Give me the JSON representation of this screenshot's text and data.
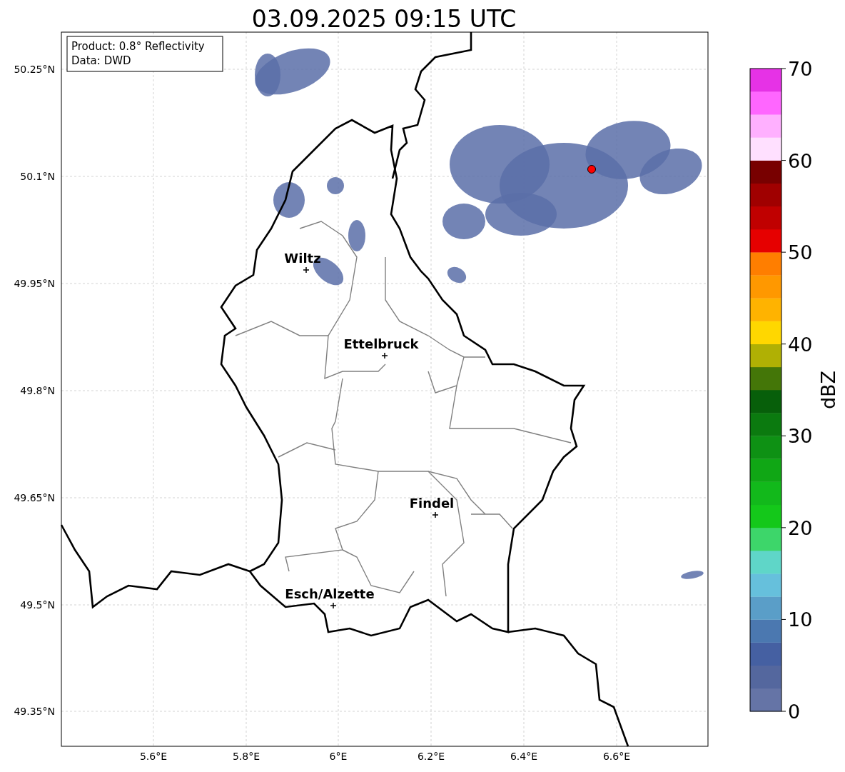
{
  "title": "03.09.2025 09:15 UTC",
  "info_box": [
    "Product: 0.8° Reflectivity",
    "Data: DWD"
  ],
  "lat_labels": [
    "50.25°N",
    "50.1°N",
    "49.95°N",
    "49.8°N",
    "49.65°N",
    "49.5°N",
    "49.35°N"
  ],
  "lon_labels": [
    "5.6°E",
    "5.8°E",
    "6°E",
    "6.2°E",
    "6.4°E",
    "6.6°E"
  ],
  "cities": [
    {
      "name": "Wiltz"
    },
    {
      "name": "Ettelbruck"
    },
    {
      "name": "Findel"
    },
    {
      "name": "Esch/Alzette"
    }
  ],
  "colorbar": {
    "label": "dBZ",
    "ticks": [
      "70",
      "60",
      "50",
      "40",
      "30",
      "20",
      "10",
      "0"
    ],
    "bins": [
      {
        "color": "#6574a6"
      },
      {
        "color": "#54679e"
      },
      {
        "color": "#4560a2"
      },
      {
        "color": "#4b78b0"
      },
      {
        "color": "#5a9ec8"
      },
      {
        "color": "#66c0dc"
      },
      {
        "color": "#5fd6c8"
      },
      {
        "color": "#3dd66a"
      },
      {
        "color": "#14c81a"
      },
      {
        "color": "#12b91b"
      },
      {
        "color": "#10a715"
      },
      {
        "color": "#0e9114"
      },
      {
        "color": "#0b7a0f"
      },
      {
        "color": "#075f0a"
      },
      {
        "color": "#447608"
      },
      {
        "color": "#b0b004"
      },
      {
        "color": "#ffd700"
      },
      {
        "color": "#ffb300"
      },
      {
        "color": "#ff9800"
      },
      {
        "color": "#ff7e00"
      },
      {
        "color": "#e60000"
      },
      {
        "color": "#c00000"
      },
      {
        "color": "#a00000"
      },
      {
        "color": "#780000"
      },
      {
        "color": "#ffe0ff"
      },
      {
        "color": "#ffb0ff"
      },
      {
        "color": "#ff66ff"
      },
      {
        "color": "#e632e6"
      }
    ]
  }
}
